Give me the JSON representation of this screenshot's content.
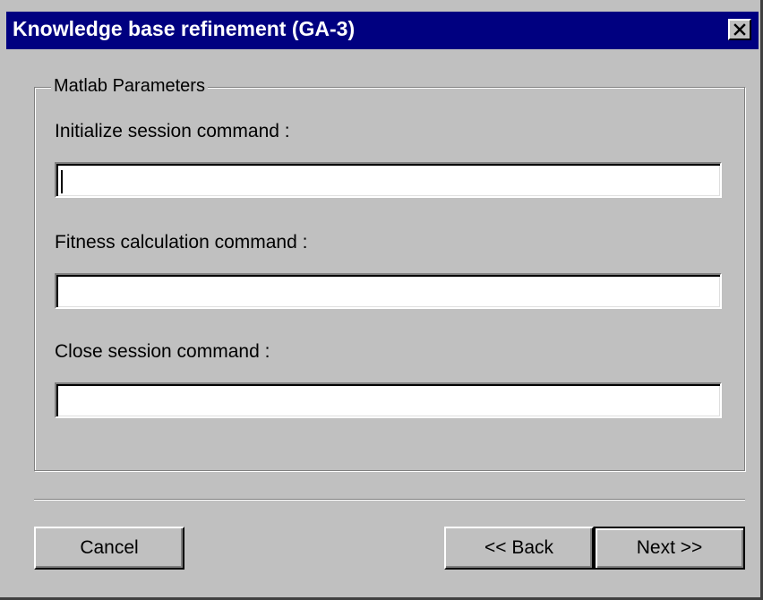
{
  "window": {
    "title": "Knowledge base refinement (GA-3)",
    "close_icon": "close-icon"
  },
  "group": {
    "legend": "Matlab Parameters",
    "fields": [
      {
        "label": "Initialize session command :",
        "value": ""
      },
      {
        "label": "Fitness calculation command :",
        "value": ""
      },
      {
        "label": "Close session command :",
        "value": ""
      }
    ]
  },
  "buttons": {
    "cancel": "Cancel",
    "back": "<< Back",
    "next": "Next >>"
  },
  "colors": {
    "titlebar": "#000080",
    "face": "#c0c0c0"
  }
}
